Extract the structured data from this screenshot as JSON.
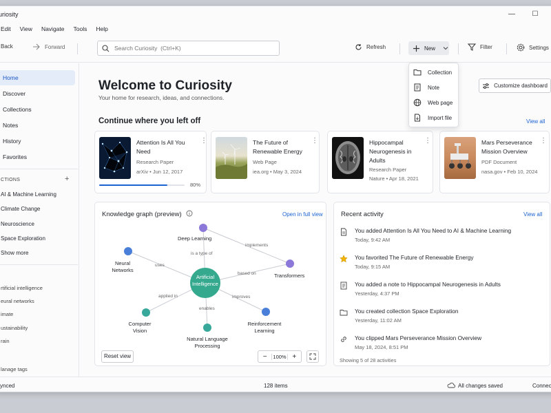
{
  "window": {
    "title": "uriosity"
  },
  "menu": [
    "Edit",
    "View",
    "Navigate",
    "Tools",
    "Help"
  ],
  "toolbar": {
    "back": "Back",
    "forward": "Forward",
    "search_placeholder": "Search Curiosity  (Ctrl+K)",
    "refresh": "Refresh",
    "new": "New",
    "filter": "Filter",
    "settings": "Settings"
  },
  "new_menu": {
    "items": [
      "Collection",
      "Note",
      "Web page",
      "Import file"
    ]
  },
  "sidebar": {
    "nav": [
      "Home",
      "Discover",
      "Collections",
      "Notes",
      "History",
      "Favorites"
    ],
    "collections_header": "CTIONS",
    "collections": [
      "AI & Machine Learning",
      "Climate Change",
      "Neuroscience",
      "Space Exploration"
    ],
    "show_more": "Show more",
    "tags": [
      "rtificial intelligence",
      "eural networks",
      "imate",
      "ustainability",
      "rain"
    ],
    "manage_tags": "lanage tags"
  },
  "main": {
    "title": "Welcome to Curiosity",
    "subtitle": "Your home for research, ideas, and connections.",
    "customize": "Customize dashboard",
    "continue_header": "Continue where you left off",
    "view_all": "View all",
    "cards": [
      {
        "title": "Attention Is All You Need",
        "type": "Research Paper",
        "meta": "arXiv • Jun 12, 2017",
        "progress": "80%",
        "progress_value": 0.8
      },
      {
        "title": "The Future of Renewable Energy",
        "type": "Web Page",
        "meta": "iea.org • May 3, 2024"
      },
      {
        "title": "Hippocampal Neurogenesis in Adults",
        "type": "Research Paper",
        "meta": "Nature • Apr 18, 2021"
      },
      {
        "title": "Mars Perseverance Mission Overview",
        "type": "PDF Document",
        "meta": "nasa.gov • Feb 10, 2024"
      }
    ]
  },
  "graph": {
    "title": "Knowledge graph (preview)",
    "open_full": "Open in full view",
    "center": "Artificial Intelligence",
    "nodes": [
      "Deep Learning",
      "Neural Networks",
      "Transformers",
      "Computer Vision",
      "Natural Language Processing",
      "Reinforcement Learning"
    ],
    "edges": [
      "is a type of",
      "implements",
      "uses",
      "based on",
      "applied in",
      "improves",
      "enables"
    ],
    "reset": "Reset view",
    "zoom": "100%",
    "colors": {
      "center": "#35a98e",
      "blue": "#4a7fd9",
      "purple": "#8c78d9",
      "teal": "#37a89a"
    }
  },
  "activity": {
    "title": "Recent activity",
    "view_all": "View all",
    "items": [
      {
        "text": "You added Attention Is All You Need to AI & Machine Learning",
        "time": "Today, 9:42 AM",
        "icon": "document-icon"
      },
      {
        "text": "You favorited The Future of Renewable Energy",
        "time": "Today, 9:15 AM",
        "icon": "star-icon"
      },
      {
        "text": "You added a note to Hippocampal Neurogenesis in Adults",
        "time": "Yesterday, 4:37 PM",
        "icon": "note-icon"
      },
      {
        "text": "You created collection Space Exploration",
        "time": "Yesterday, 11:02 AM",
        "icon": "folder-icon"
      },
      {
        "text": "You clipped Mars Perseverance Mission Overview",
        "time": "May 18, 2024, 8:51 PM",
        "icon": "link-icon"
      }
    ],
    "showing": "Showing 5 of 28 activities"
  },
  "status": {
    "left": "ynced",
    "center": "128 items",
    "saved": "All changes saved",
    "right": "Connec"
  }
}
